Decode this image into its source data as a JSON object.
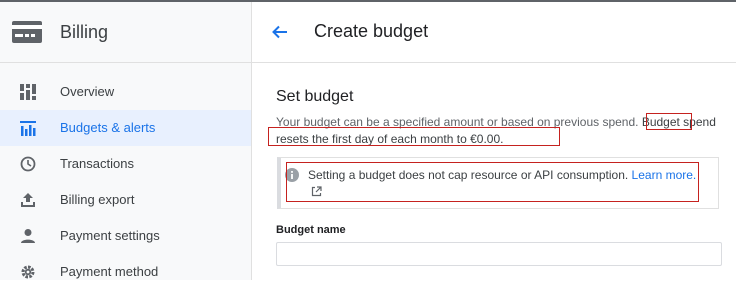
{
  "app": {
    "title": "Billing"
  },
  "sidebar": {
    "items": [
      {
        "label": "Overview",
        "icon": "dashboard-icon",
        "active": false
      },
      {
        "label": "Budgets & alerts",
        "icon": "budget-chart-icon",
        "active": true
      },
      {
        "label": "Transactions",
        "icon": "clock-icon",
        "active": false
      },
      {
        "label": "Billing export",
        "icon": "upload-icon",
        "active": false
      },
      {
        "label": "Payment settings",
        "icon": "person-icon",
        "active": false
      },
      {
        "label": "Payment method",
        "icon": "gear-icon",
        "active": false
      }
    ]
  },
  "header": {
    "title": "Create budget"
  },
  "content": {
    "section_title": "Set budget",
    "description_part1": "Your budget can be a specified amount or based on previous spend. ",
    "description_part2": "Budget spend resets the first day of each month to €0.00.",
    "info_text": "Setting a budget does not cap resource or API consumption. ",
    "info_link": "Learn more.",
    "budget_name_label": "Budget name",
    "budget_name_value": ""
  },
  "colors": {
    "accent": "#1a73e8",
    "highlight_box": "#c5221f",
    "active_bg": "#e8f0fe"
  }
}
